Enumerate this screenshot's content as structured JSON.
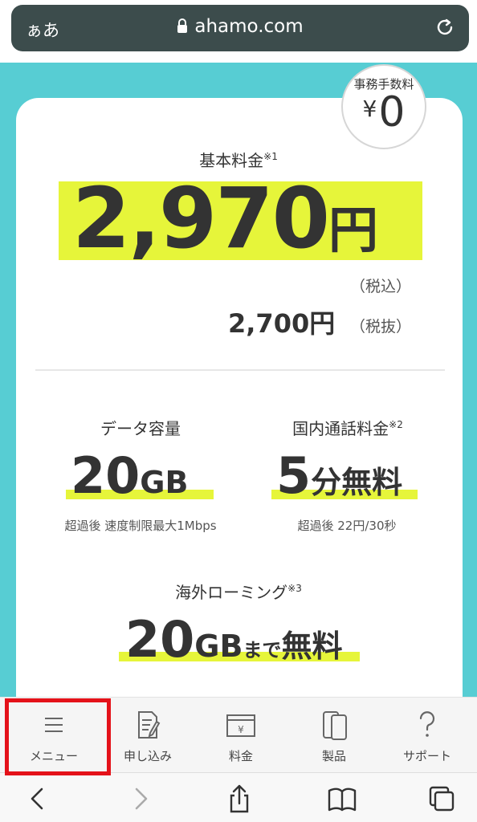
{
  "browser": {
    "aa_label": "ぁあ",
    "url": "ahamo.com"
  },
  "plan": {
    "fee_badge": {
      "label": "事務手数料",
      "currency": "¥",
      "value": "0"
    },
    "base_fee_label": "基本料金",
    "base_fee_note": "※1",
    "price_tax_in": "2,970",
    "price_unit": "円",
    "tax_in_label": "（税込）",
    "price_tax_ex": "2,700円",
    "tax_ex_label": "（税抜）",
    "data": {
      "label": "データ容量",
      "value": "20",
      "unit": "GB",
      "note": "超過後 速度制限最大1Mbps"
    },
    "call": {
      "label": "国内通話料金",
      "note_ref": "※2",
      "value": "5",
      "unit": "分無料",
      "note": "超過後 22円/30秒"
    },
    "roaming": {
      "label": "海外ローミング",
      "note_ref": "※3",
      "value": "20",
      "unit": "GB",
      "suffix": "まで",
      "free": "無料"
    }
  },
  "site_nav": {
    "items": [
      {
        "label": "メニュー",
        "icon": "menu-icon"
      },
      {
        "label": "申し込み",
        "icon": "form-icon"
      },
      {
        "label": "料金",
        "icon": "price-icon"
      },
      {
        "label": "製品",
        "icon": "phone-icon"
      },
      {
        "label": "サポート",
        "icon": "help-icon"
      }
    ]
  },
  "colors": {
    "accent_yellow": "#e6f53a",
    "brand_teal": "#57cdd3",
    "highlight_red": "#e4121a"
  }
}
